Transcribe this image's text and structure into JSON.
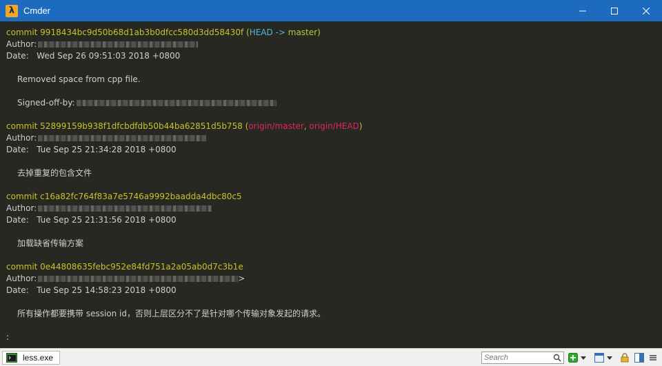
{
  "window": {
    "title": "Cmder",
    "app_icon": "λ",
    "controls": [
      "minimize-icon",
      "maximize-icon",
      "close-icon"
    ]
  },
  "log": {
    "commit1": {
      "commit": "commit 9918434bc9d50b68d1ab3b0dfcc580d3dd58430f",
      "ref_open": " (",
      "head": "HEAD",
      "arrow": " -> ",
      "branch": "master",
      "ref_close": ")",
      "author": "Author:",
      "date": "Date:   Wed Sep 26 09:51:03 2018 +0800",
      "message": "Removed space from cpp file.",
      "signoff": "Signed-off-by:"
    },
    "commit2": {
      "commit": "commit 52899159b938f1dfcbdfdb50b44ba62851d5b758",
      "ref_open": " (",
      "ref1": "origin/master",
      "sep": ", ",
      "ref2": "origin/HEAD",
      "ref_close": ")",
      "author": "Author:",
      "date": "Date:   Tue Sep 25 21:34:28 2018 +0800",
      "message": "去掉重复的包含文件"
    },
    "commit3": {
      "commit": "commit c16a82fc764f83a7e5746a9992baadda4dbc80c5",
      "author": "Author:",
      "date": "Date:   Tue Sep 25 21:31:56 2018 +0800",
      "message": "加载缺省传输方案"
    },
    "commit4": {
      "commit": "commit 0e44808635febc952e84fd751a2a05ab0d7c3b1e",
      "author": "Author:",
      "author_tail": ">",
      "date": "Date:   Tue Sep 25 14:58:23 2018 +0800",
      "message": "所有操作都要携带 session id，否则上层区分不了是针对哪个传输对象发起的请求。"
    },
    "prompt": ":"
  },
  "statusbar": {
    "tab_label": "less.exe",
    "search_placeholder": "Search"
  },
  "colors": {
    "titlebar": "#1c6bbf",
    "terminal_bg": "#272822",
    "commit": "#c6c32a",
    "head": "#58b5dc",
    "branch": "#a6d23b",
    "remote": "#e0245e"
  }
}
